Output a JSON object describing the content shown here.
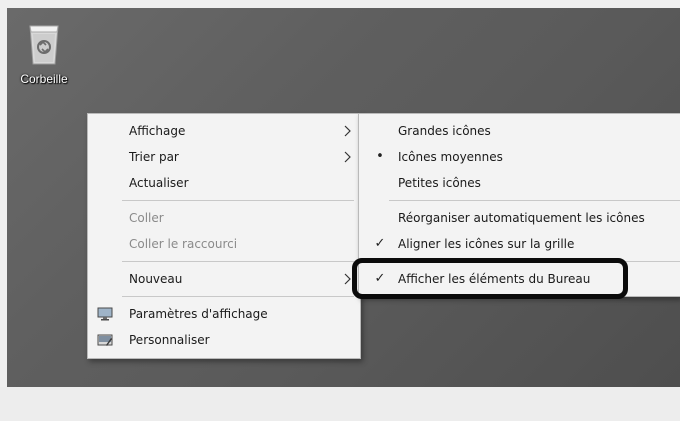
{
  "desktop": {
    "recycle_bin": {
      "label": "Corbeille",
      "icon": "recycle-bin-icon"
    }
  },
  "context_menu": {
    "items": [
      {
        "label": "Affichage",
        "has_submenu": true
      },
      {
        "label": "Trier par",
        "has_submenu": true
      },
      {
        "label": "Actualiser"
      },
      {
        "label": "Coller",
        "disabled": true
      },
      {
        "label": "Coller le raccourci",
        "disabled": true
      },
      {
        "label": "Nouveau",
        "has_submenu": true
      },
      {
        "label": "Paramètres d'affichage",
        "icon": "display-settings-icon"
      },
      {
        "label": "Personnaliser",
        "icon": "personalize-icon"
      }
    ]
  },
  "view_submenu": {
    "items": [
      {
        "label": "Grandes icônes"
      },
      {
        "label": "Icônes moyennes",
        "selected": true,
        "mark": "•"
      },
      {
        "label": "Petites icônes"
      },
      {
        "label": "Réorganiser automatiquement les icônes"
      },
      {
        "label": "Aligner les icônes sur la grille",
        "checked": true,
        "mark": "✓"
      },
      {
        "label": "Afficher les éléments du Bureau",
        "checked": true,
        "mark": "✓",
        "highlighted": true
      }
    ]
  },
  "colors": {
    "desktop": "#5f5f5f",
    "menu_background": "#f3f3f3",
    "disabled_text": "#8a8a8a",
    "highlight_outline": "#0b0b0b"
  }
}
